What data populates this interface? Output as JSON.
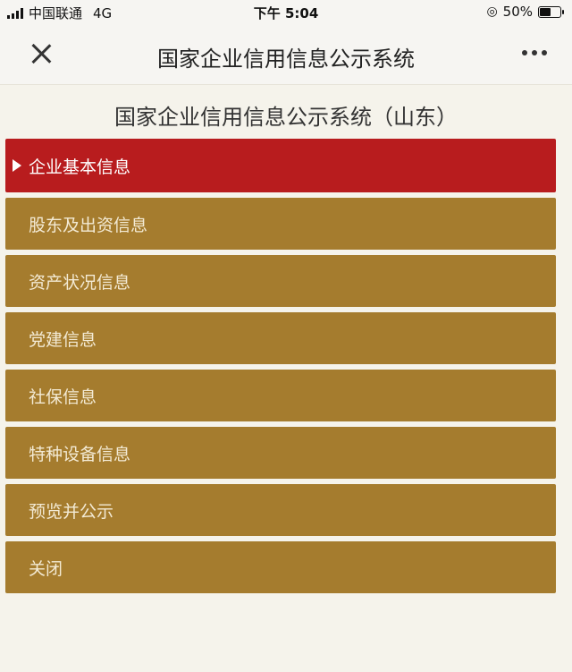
{
  "status": {
    "carrier": "中国联通",
    "network": "4G",
    "time": "下午 5:04",
    "battery_text": "50%",
    "battery_level": 0.5
  },
  "nav": {
    "title": "国家企业信用信息公示系统"
  },
  "page": {
    "title": "国家企业信用信息公示系统（山东）"
  },
  "menu": {
    "items": [
      {
        "label": "企业基本信息",
        "active": true
      },
      {
        "label": "股东及出资信息"
      },
      {
        "label": "资产状况信息"
      },
      {
        "label": "党建信息"
      },
      {
        "label": "社保信息"
      },
      {
        "label": "特种设备信息"
      },
      {
        "label": "预览并公示"
      },
      {
        "label": "关闭"
      }
    ]
  },
  "colors": {
    "active": "#b81c1e",
    "item": "#a57c2e",
    "background": "#f5f3eb"
  }
}
